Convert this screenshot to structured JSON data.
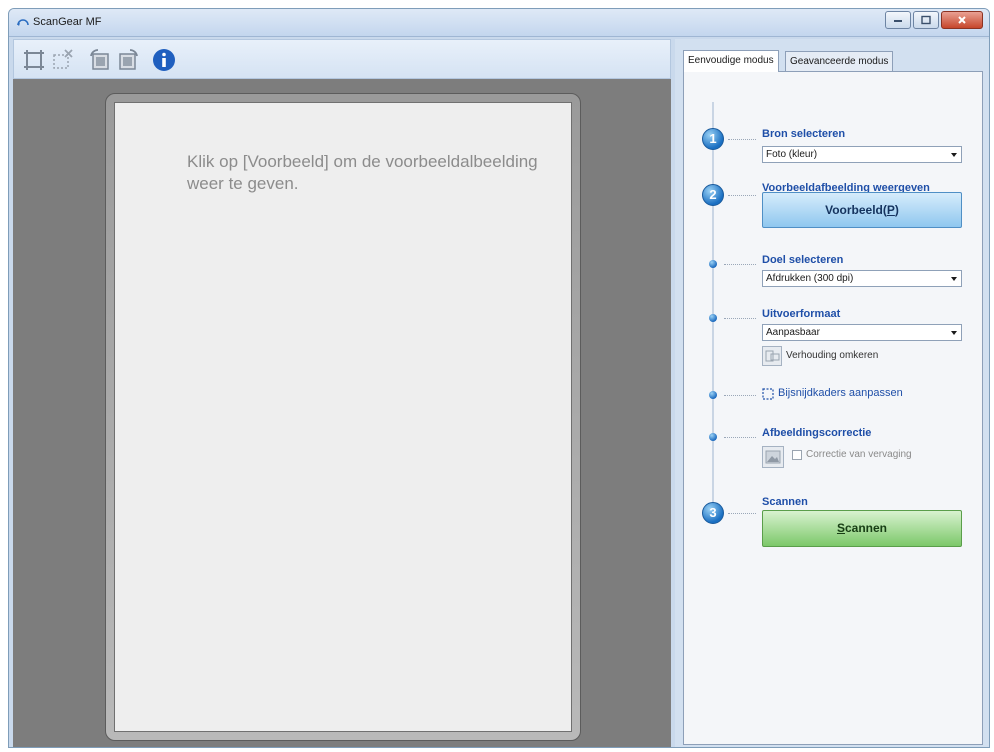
{
  "window": {
    "title": "ScanGear MF"
  },
  "toolbar": {
    "icons": [
      "crop-auto-icon",
      "crop-remove-icon",
      "rotate-left-icon",
      "rotate-right-icon",
      "info-icon"
    ]
  },
  "preview": {
    "message": "Klik op [Voorbeeld] om de voorbeeldalbeelding weer te geven."
  },
  "tabs": [
    {
      "label": "Eenvoudige modus",
      "active": true
    },
    {
      "label": "Geavanceerde modus",
      "active": false
    }
  ],
  "steps": {
    "source": {
      "number": "1",
      "heading": "Bron selecteren",
      "selected": "Foto (kleur)"
    },
    "preview": {
      "number": "2",
      "heading": "Voorbeeldafbeelding weergeven",
      "button_text": "Voorbeeld(",
      "button_key": "P",
      "button_end": ")"
    },
    "destination": {
      "heading": "Doel selecteren",
      "selected": "Afdrukken (300 dpi)"
    },
    "output": {
      "heading": "Uitvoerformaat",
      "selected": "Aanpasbaar",
      "swap_label": "Verhouding omkeren"
    },
    "crop": {
      "label": "Bijsnijdkaders aanpassen"
    },
    "correction": {
      "heading": "Afbeeldingscorrectie",
      "checkbox_label": "Correctie van vervaging"
    },
    "scan": {
      "number": "3",
      "heading": "Scannen",
      "button_key": "S",
      "button_rest": "cannen"
    }
  },
  "colors": {
    "accent": "#1f4fa8",
    "preview_button": "#8fc7ef",
    "scan_button": "#7cc86a"
  }
}
